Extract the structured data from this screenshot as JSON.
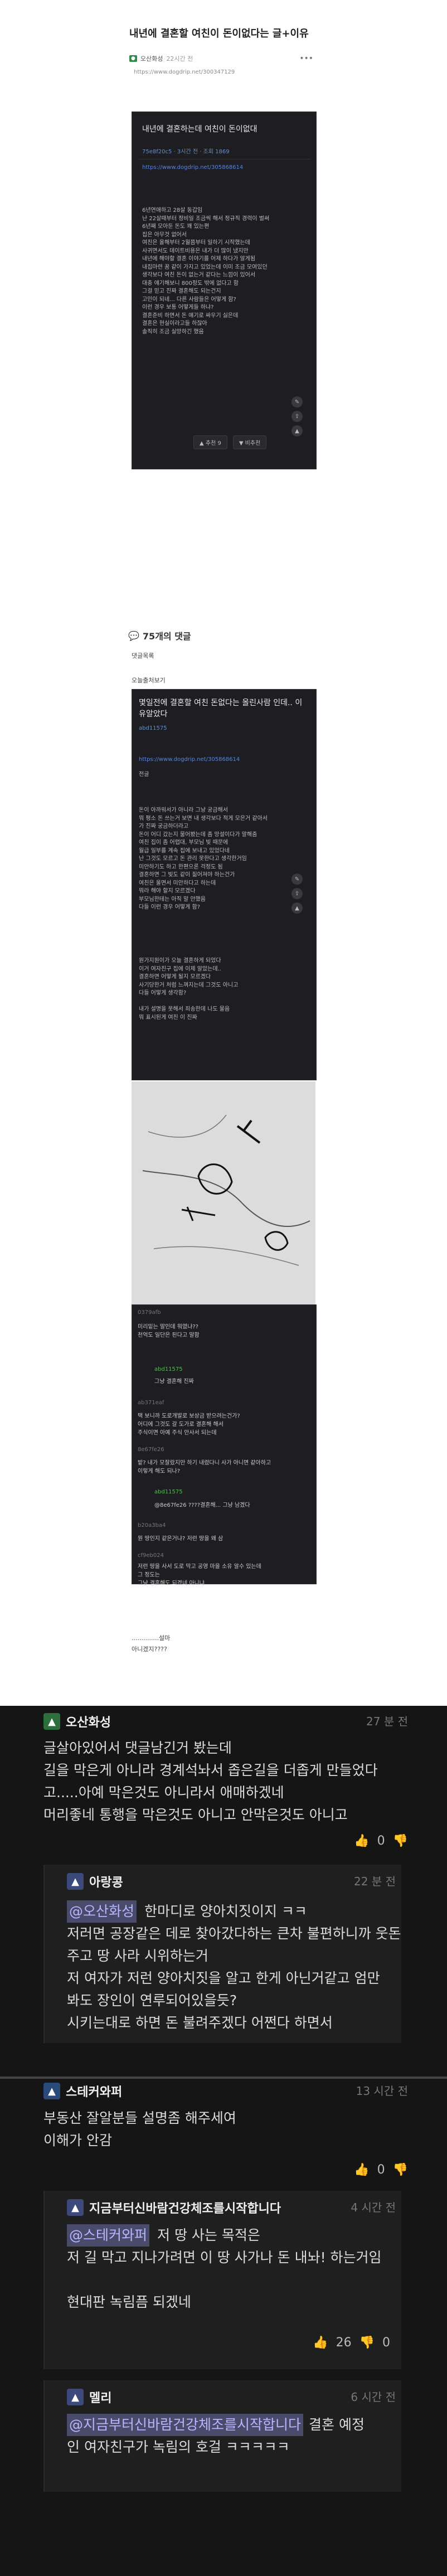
{
  "post": {
    "title": "내년에 결혼할 여친이 돈이없다는 글+이유",
    "author": "오산화성",
    "author_badge": "●",
    "time": "22시간 전",
    "dots": "•••",
    "url": "https://www.dogdrip.net/300347129"
  },
  "screenshot1": {
    "title": "내년에 결혼하는데 여친이 돈이없대",
    "sub": "75e8f20c5   ·   3시간 전   ·   조회 1869",
    "link": "https://www.dogdrip.net/305868614",
    "body": "6년연애하고 28살 동갑임\n난 22살때부터 정비일 조금씩 해서 정규직 경력이 벌써\n6년째 모아둔 돈도 꽤 있는편\n집은 아무것 없어서\n여친은 올해부터 2월쯤부터 일하기 시작했는데\n사귀면서도 데이트비용은 내가 더 많이 냈지만\n내년에 해야할 결혼 이야기를 어제 하다가 알게됨\n내집마련 꿈 같이 가지고 있었는데 이미 조금 모여있던\n생각보다 여친 돈이 없는거 같다는 느낌이 있어서\n대충 얘기해보니 800정도 밖에 없다고 함\n그걸 믿고 진짜 결혼해도 되는건지\n고민이 되네... 다른 사람들은 어떻게 함?\n이런 경우 보통 어떻게들 하냐?\n결혼준비 하면서 돈 얘기로 싸우기 싫은데\n결혼은 현실이라고들 하잖아\n솔직히 조금 실망하긴 했음",
    "up": "▲ 추천 9",
    "down": "▼ 비추천"
  },
  "comments_count": "75개의 댓글",
  "text_lines": [
    "댓글목록",
    "오늘출처보기"
  ],
  "screenshot2": {
    "title": "몇일전에 결혼할 여친 돈없다는 올린사람 인데.. 이유알았다",
    "author": "abd11575",
    "link": "https://www.dogdrip.net/305868614",
    "pre": "전글",
    "body": "돈이 아까워서가 아니라 그냥 궁금해서\n뭐 평소 돈 쓰는거 보면 내 생각보다 적게 모은거 같아서\n가 진짜 궁금하더라고\n돈이 어디 갔는지 물어봤는데 좀 망설이다가 말해줌\n여친 집이 좀 어렵대, 부모님 빚 때문에\n월급 일부를 계속 집에 보내고 있었다네\n난 그것도 모르고 돈 관리 못한다고 생각한거임\n미안하기도 하고 한편으론 걱정도 됨\n결혼하면 그 빚도 같이 짊어져야 하는건가\n여친은 울면서 미안하다고 하는데\n뭐라 해야 할지 모르겠다\n부모님한테는 아직 말 안했음\n다들 이런 경우 어떻게 함?",
    "extra": "원가지원이가 오늘 결혼하게 되었다\n이거 여자친구 집에 이제 알았는데..\n결혼하면 어떻게 될지 모르겠다\n사기당한거 처럼 느껴지는데 그것도 아니고\n다들 어떻게 생각함?\n\n내가 설명을 못해서 죄송한데 나도 물음\n뭐 표시된게 여친 이 진짜"
  },
  "drawing_comments": [
    {
      "name": "0379afb",
      "text": "미리밑는 말인데 뭐였냐??\n천억도 일단은 된다고 말함"
    },
    {
      "name": "abd11575",
      "text": "그냥 결혼해 진짜"
    },
    {
      "name": "ab371eaf",
      "text": "택 보니까 도로개발로 보상금 받으려는건가?\n어디에 그것도 갈 도가로 결혼해 해서\n주식이면 아예 주식 안사서 되는데"
    },
    {
      "name": "8e67fe26",
      "text": "밭? 내가 모잘랐지만 하기 내렸다니 사가 아니면 같아하고\n이렇게 해도 되나?"
    },
    {
      "name": "abd11575",
      "text": "@8e67fe26  ????결혼해... 그냥 남겠다"
    },
    {
      "name": "b20a3ba4",
      "text": "뭔 땅인지 같은거냐? 저런 땅을 왜 삼"
    },
    {
      "name": "cf9eb024",
      "text": "저런 땅을 사서 도로 막고 공영 마을 소유 알수 있는데\n그 정도는\n그냥 결혼해도 되겠네 아니냐"
    }
  ],
  "plain_end": [
    "..............설마",
    "아니겠지????"
  ],
  "big": {
    "c1": {
      "name": "오산화성",
      "time": "27 분 전",
      "text": [
        "글살아있어서 댓글남긴거 봤는데",
        "길을 막은게 아니라 경계석놔서 좁은길을 더좁게 만들었다",
        "고.....아예 막은것도 아니라서 애매하겠네",
        "머리좋네 통행을 막은것도 아니고 안막은것도 아니고"
      ],
      "up": "0",
      "down": "0"
    },
    "r1": {
      "name": "아랑콩",
      "time": "22 분 전",
      "mention": "@오산화성",
      "text": [
        "한마디로 양아치짓이지 ㅋㅋ",
        "저러면 공장같은 데로 찾아갔다하는 큰차 불편하니까 웃돈",
        "주고 땅 사라 시위하는거",
        "저 여자가 저런 양아치짓을 알고 한게 아닌거같고 엄만",
        "봐도 장인이 연루되어있을듯?",
        "시키는대로 하면 돈 불려주겠다 어쩐다 하면서"
      ],
      "up": "0",
      "down": "0"
    },
    "c2": {
      "name": "스테커와퍼",
      "time": "13 시간 전",
      "text": [
        "부동산 잘알분들 설명좀 해주세여",
        "이해가 안감"
      ],
      "up": "0",
      "down": "0"
    },
    "r2": {
      "name": "지금부터신바람건강체조를시작합니다",
      "time": "4 시간 전",
      "mention": "@스테커와퍼",
      "text": [
        "저 땅 사는 목적은",
        "저 길 막고 지나가려면 이 땅 사가나 돈 내놔! 하는거임",
        "",
        "현대판 녹림픔 되겠네"
      ],
      "up": "26",
      "down": "0"
    },
    "r3": {
      "name": "멜리",
      "time": "6 시간 전",
      "mention": "@지금부터신바람건강체조를시작합니다",
      "text": [
        "결혼 예정",
        "인 여자친구가 녹림의 호걸 ㅋㅋㅋㅋㅋ"
      ]
    }
  }
}
